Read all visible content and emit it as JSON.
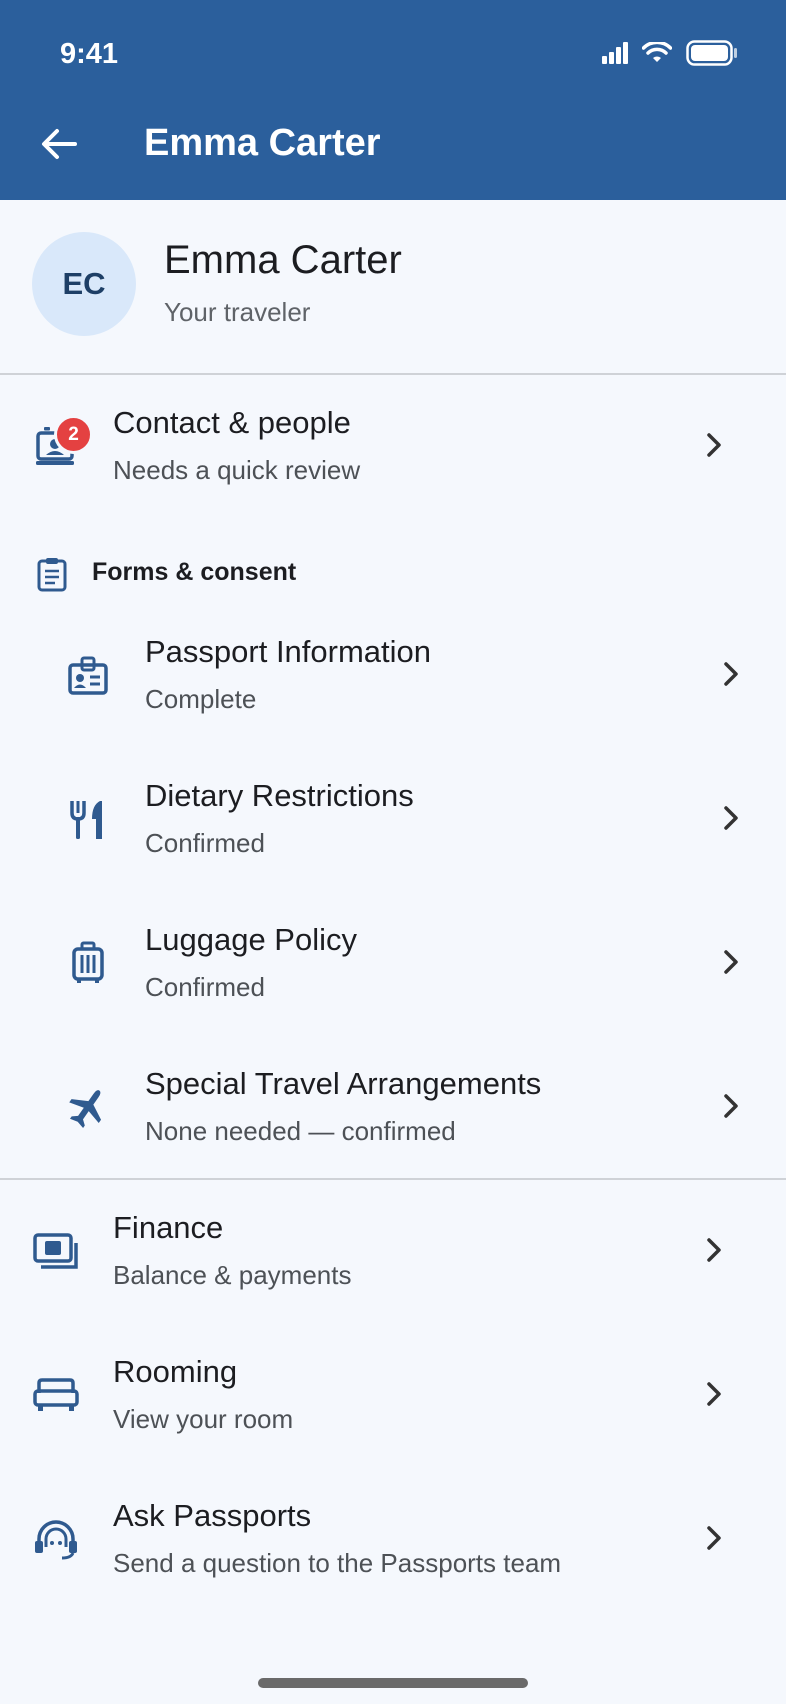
{
  "status_bar": {
    "time": "9:41"
  },
  "header": {
    "title": "Emma Carter"
  },
  "profile": {
    "initials": "EC",
    "name": "Emma Carter",
    "subtitle": "Your traveler"
  },
  "contact": {
    "title": "Contact & people",
    "subtitle": "Needs a quick review",
    "badge": "2"
  },
  "forms_section": {
    "label": "Forms & consent"
  },
  "forms": [
    {
      "title": "Passport Information",
      "subtitle": "Complete"
    },
    {
      "title": "Dietary Restrictions",
      "subtitle": "Confirmed"
    },
    {
      "title": "Luggage Policy",
      "subtitle": "Confirmed"
    },
    {
      "title": "Special Travel Arrangements",
      "subtitle": "None needed — confirmed"
    }
  ],
  "menu": [
    {
      "title": "Finance",
      "subtitle": "Balance & payments"
    },
    {
      "title": "Rooming",
      "subtitle": "View your room"
    },
    {
      "title": "Ask Passports",
      "subtitle": "Send a question to the Passports team"
    }
  ],
  "colors": {
    "header": "#2b5f9c",
    "icon": "#2f5a8f",
    "badge": "#e44141",
    "avatar_bg": "#d9e8fa"
  }
}
